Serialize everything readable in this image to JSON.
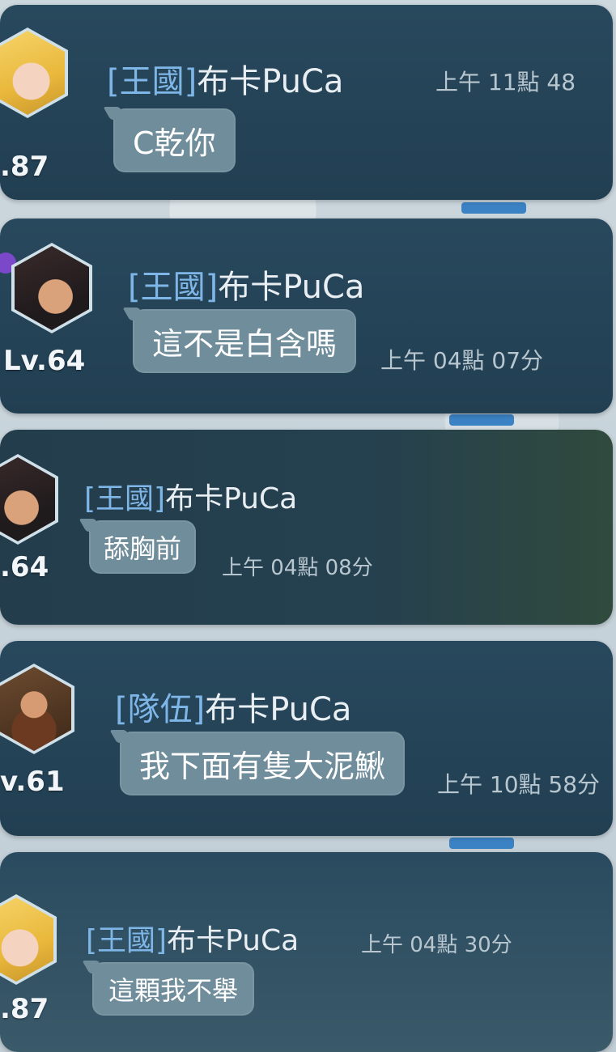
{
  "messages": [
    {
      "channel": "[王國]",
      "sender": "布卡PuCa",
      "time": "上午 11點 48",
      "text": "C乾你",
      "level": ".87",
      "avatar": "blonde-girl-avatar"
    },
    {
      "channel": "[王國]",
      "sender": "布卡PuCa",
      "time": "上午 04點 07分",
      "text": "這不是白含嗎",
      "level": "Lv.64",
      "avatar": "dark-hair-avatar"
    },
    {
      "channel": "[王國]",
      "sender": "布卡PuCa",
      "time": "上午 04點 08分",
      "text": "舔胸前",
      "level": ".64",
      "avatar": "dark-hair-avatar"
    },
    {
      "channel": "[隊伍]",
      "sender": "布卡PuCa",
      "time": "上午 10點 58分",
      "text": "我下面有隻大泥鰍",
      "level": "v.61",
      "avatar": "bearded-man-avatar"
    },
    {
      "channel": "[王國]",
      "sender": "布卡PuCa",
      "time": "上午 04點 30分",
      "text": "這顆我不舉",
      "level": ".87",
      "avatar": "blonde-girl-avatar"
    }
  ],
  "colors": {
    "card_bg": "#25445a",
    "bubble_bg": "#6f8d9b",
    "tag_blue": "#7fb6e8"
  }
}
